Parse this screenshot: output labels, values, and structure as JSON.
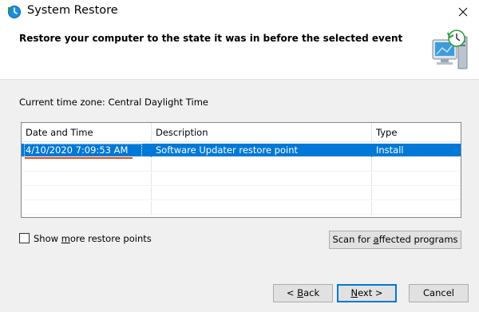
{
  "window": {
    "title": "System Restore",
    "close_label": "✕"
  },
  "header": {
    "text": "Restore your computer to the state it was in before the selected event"
  },
  "timezone": {
    "label": "Current time zone: Central Daylight Time"
  },
  "list": {
    "columns": [
      "Date and Time",
      "Description",
      "Type"
    ],
    "sort_indicator": "⌄",
    "rows": [
      {
        "date": "4/10/2020 7:09:53 AM",
        "description": "Software Updater restore point",
        "type": "Install",
        "selected": true
      },
      {
        "date": "",
        "description": "",
        "type": ""
      },
      {
        "date": "",
        "description": "",
        "type": ""
      },
      {
        "date": "",
        "description": "",
        "type": ""
      },
      {
        "date": "",
        "description": "",
        "type": ""
      }
    ]
  },
  "checkbox": {
    "label_pre": "Show ",
    "label_accel": "m",
    "label_post": "ore restore points",
    "checked": false
  },
  "buttons": {
    "scan_pre": "Scan for ",
    "scan_accel": "a",
    "scan_post": "ffected programs",
    "back_pre": "< ",
    "back_accel": "B",
    "back_post": "ack",
    "next_accel": "N",
    "next_post": "ext >",
    "cancel": "Cancel"
  },
  "colors": {
    "selection": "#0078d7",
    "annotation": "#e04a1c"
  }
}
